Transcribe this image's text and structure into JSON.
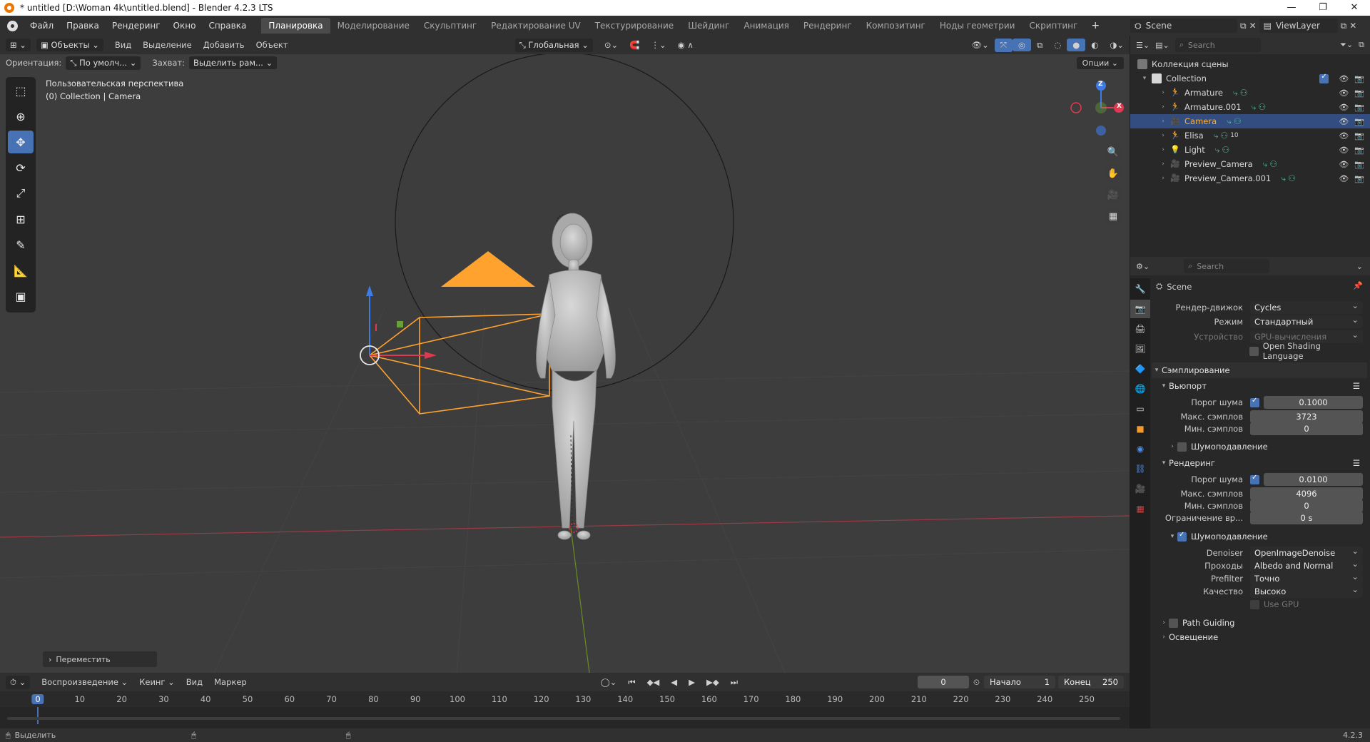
{
  "window": {
    "title": "* untitled [D:\\Woman 4k\\untitled.blend] - Blender 4.2.3 LTS"
  },
  "menu": [
    "Файл",
    "Правка",
    "Рендеринг",
    "Окно",
    "Справка"
  ],
  "workspaces": [
    "Планировка",
    "Моделирование",
    "Скульптинг",
    "Редактирование UV",
    "Текстурирование",
    "Шейдинг",
    "Анимация",
    "Рендеринг",
    "Композитинг",
    "Ноды геометрии",
    "Скриптинг"
  ],
  "active_workspace": "Планировка",
  "scene_selector": {
    "scene": "Scene",
    "view_layer": "ViewLayer"
  },
  "viewport": {
    "mode": "Объекты",
    "menus": [
      "Вид",
      "Выделение",
      "Добавить",
      "Объект"
    ],
    "transform_orientation": "Глобальная",
    "orientation_label": "Ориентация:",
    "orientation_value": "По умолч...",
    "snap_label": "Захват:",
    "snap_value": "Выделить рам...",
    "options_label": "Опции",
    "view_name": "Пользовательская перспектива",
    "collection_info": "(0) Collection | Camera",
    "last_operator": "Переместить",
    "gizmo_axes": [
      "Z",
      "X",
      "Y"
    ]
  },
  "timeline": {
    "menus": [
      "Воспроизведение",
      "Кеинг",
      "Вид",
      "Маркер"
    ],
    "current_frame": "0",
    "start_label": "Начало",
    "start": "1",
    "end_label": "Конец",
    "end": "250",
    "ticks": [
      "0",
      "10",
      "20",
      "30",
      "40",
      "50",
      "60",
      "70",
      "80",
      "90",
      "100",
      "110",
      "120",
      "130",
      "140",
      "150",
      "160",
      "170",
      "180",
      "190",
      "200",
      "210",
      "220",
      "230",
      "240",
      "250"
    ]
  },
  "statusbar": {
    "left": "Выделить",
    "version": "4.2.3"
  },
  "outliner": {
    "search_placeholder": "Search",
    "scene_collection": "Коллекция сцены",
    "collection": "Collection",
    "items": [
      {
        "name": "Armature",
        "icon": "armature-icon"
      },
      {
        "name": "Armature.001",
        "icon": "armature-icon"
      },
      {
        "name": "Camera",
        "icon": "camera-icon",
        "selected": true
      },
      {
        "name": "Elisa",
        "icon": "armature-icon",
        "badge": "10"
      },
      {
        "name": "Light",
        "icon": "light-icon"
      },
      {
        "name": "Preview_Camera",
        "icon": "camera-icon"
      },
      {
        "name": "Preview_Camera.001",
        "icon": "camera-icon"
      }
    ]
  },
  "properties": {
    "search_placeholder": "Search",
    "context": "Scene",
    "render_engine_label": "Рендер-движок",
    "render_engine": "Cycles",
    "mode_label": "Режим",
    "mode": "Стандартный",
    "device_label": "Устройство",
    "device": "GPU-вычисления",
    "osl": "Open Shading Language",
    "sampling": "Сэмплирование",
    "viewport_section": "Вьюпорт",
    "render_section": "Рендеринг",
    "noise_threshold_label": "Порог шума",
    "max_samples_label": "Макс. сэмплов",
    "min_samples_label": "Мин. сэмплов",
    "time_limit_label": "Ограничение вр...",
    "viewport_noise_threshold": "0.1000",
    "viewport_max_samples": "3723",
    "viewport_min_samples": "0",
    "denoise_label": "Шумоподавление",
    "render_noise_threshold": "0.0100",
    "render_max_samples": "4096",
    "render_min_samples": "0",
    "time_limit": "0 s",
    "denoiser_label": "Denoiser",
    "denoiser": "OpenImageDenoise",
    "passes_label": "Проходы",
    "passes": "Albedo and Normal",
    "prefilter_label": "Prefilter",
    "prefilter": "Точно",
    "quality_label": "Качество",
    "quality": "Высоко",
    "use_gpu": "Use GPU",
    "path_guiding": "Path Guiding",
    "lighting": "Освещение"
  },
  "colors": {
    "accent": "#4772b3",
    "selection": "#ffaf29",
    "camera": "#ffa32e"
  }
}
